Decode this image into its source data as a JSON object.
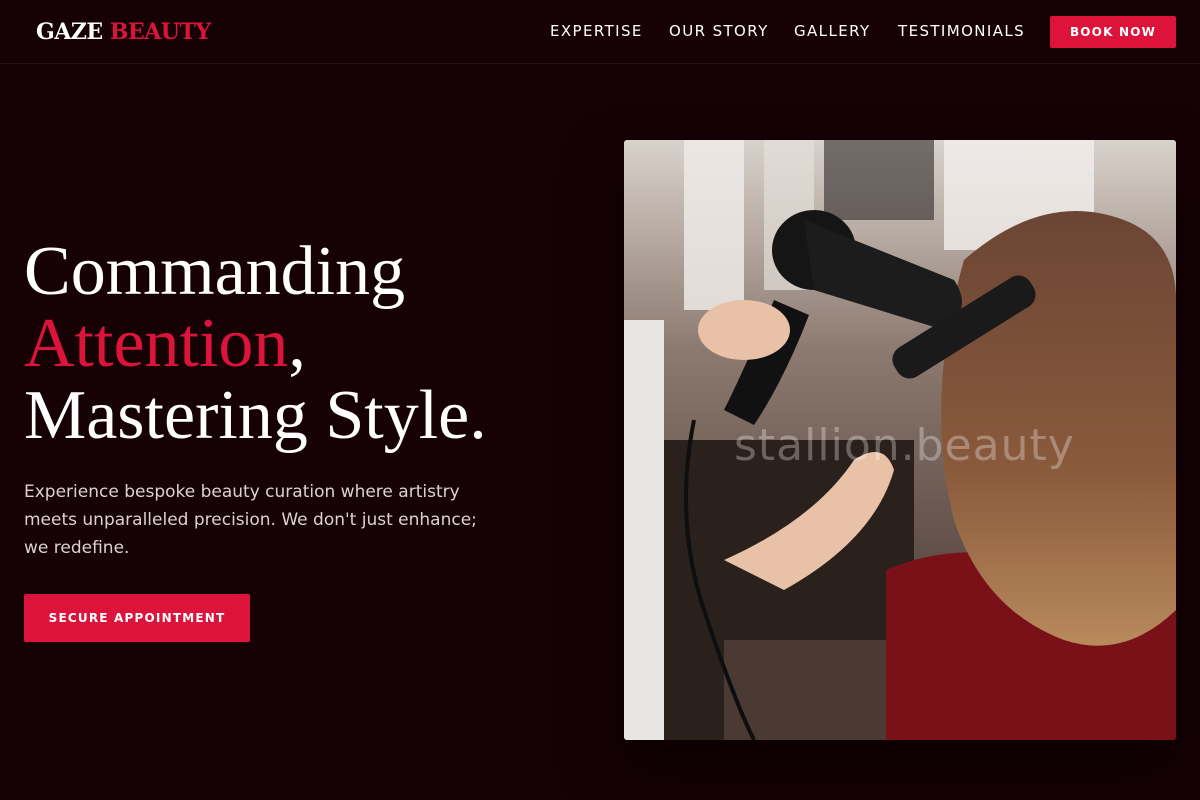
{
  "brand": {
    "first": "GAZE",
    "second": "BEAUTY"
  },
  "nav": {
    "items": [
      "EXPERTISE",
      "OUR STORY",
      "GALLERY",
      "TESTIMONIALS"
    ],
    "book_label": "BOOK NOW"
  },
  "hero": {
    "line1": "Commanding",
    "line2_accent": "Attention",
    "line2_suffix": ",",
    "line3": "Mastering Style.",
    "description": "Experience bespoke beauty curation where artistry meets unparalleled precision. We don't just enhance; we redefine.",
    "cta_label": "SECURE APPOINTMENT"
  },
  "image": {
    "watermark": "stallion.beauty"
  },
  "colors": {
    "background": "#160105",
    "accent": "#dc143c",
    "text": "#ffffff"
  }
}
